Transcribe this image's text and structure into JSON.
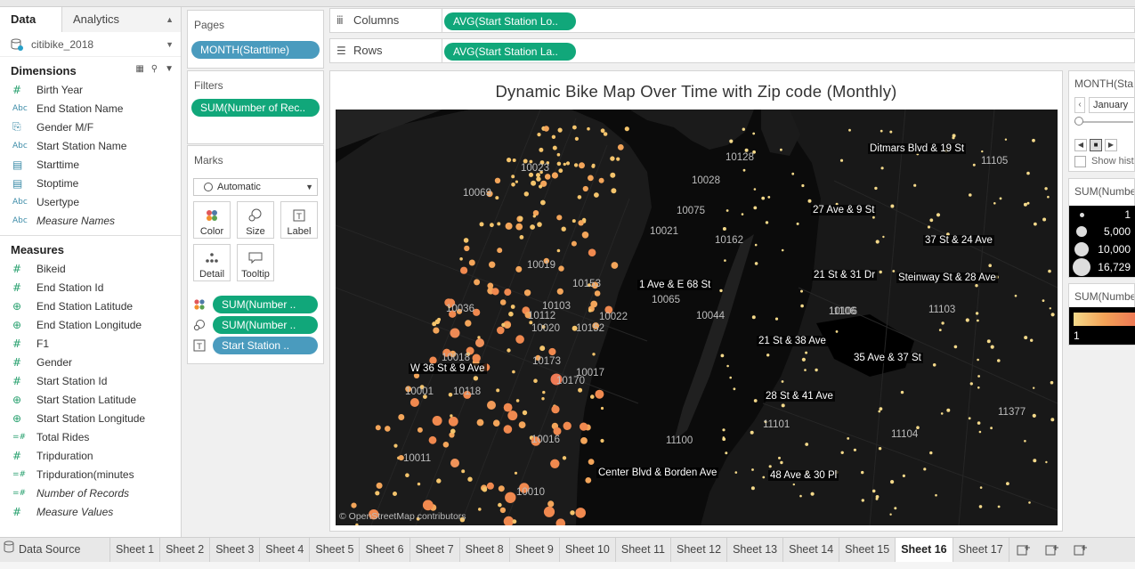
{
  "left_pane": {
    "tabs": [
      "Data",
      "Analytics"
    ],
    "datasource": "citibike_2018",
    "dimensions_title": "Dimensions",
    "measures_title": "Measures",
    "dimensions": [
      {
        "label": "Birth Year",
        "type": "#"
      },
      {
        "label": "End Station Name",
        "type": "Abc"
      },
      {
        "label": "Gender M/F",
        "type": "clip"
      },
      {
        "label": "Start Station Name",
        "type": "Abc"
      },
      {
        "label": "Starttime",
        "type": "date"
      },
      {
        "label": "Stoptime",
        "type": "date"
      },
      {
        "label": "Usertype",
        "type": "Abc"
      },
      {
        "label": "Measure Names",
        "type": "Abc",
        "italic": true
      }
    ],
    "measures": [
      {
        "label": "Bikeid",
        "type": "#"
      },
      {
        "label": "End Station Id",
        "type": "#"
      },
      {
        "label": "End Station Latitude",
        "type": "globe"
      },
      {
        "label": "End Station Longitude",
        "type": "globe"
      },
      {
        "label": "F1",
        "type": "#"
      },
      {
        "label": "Gender",
        "type": "#"
      },
      {
        "label": "Start Station Id",
        "type": "#"
      },
      {
        "label": "Start Station Latitude",
        "type": "globe"
      },
      {
        "label": "Start Station Longitude",
        "type": "globe"
      },
      {
        "label": "Total Rides",
        "type": "=#"
      },
      {
        "label": "Tripduration",
        "type": "#"
      },
      {
        "label": "Tripduration(minutes",
        "type": "=#"
      },
      {
        "label": "Number of Records",
        "type": "=#",
        "italic": true
      },
      {
        "label": "Measure Values",
        "type": "#",
        "italic": true
      }
    ]
  },
  "pages": {
    "title": "Pages",
    "pill": "MONTH(Starttime)"
  },
  "filters": {
    "title": "Filters",
    "pill": "SUM(Number of Rec.."
  },
  "marks": {
    "title": "Marks",
    "type": "Automatic",
    "buttons": [
      "Color",
      "Size",
      "Label",
      "Detail",
      "Tooltip"
    ],
    "pills": [
      "SUM(Number ..",
      "SUM(Number ..",
      "Start Station .."
    ]
  },
  "shelves": {
    "columns_label": "Columns",
    "columns_pill": "AVG(Start Station Lo..",
    "rows_label": "Rows",
    "rows_pill": "AVG(Start Station La.."
  },
  "view": {
    "title": "Dynamic Bike Map Over Time with Zip code (Monthly)",
    "credit": "© OpenStreetMap contributors",
    "zip_labels": [
      "10023",
      "10128",
      "10069",
      "10028",
      "10075",
      "10021",
      "10162",
      "10019",
      "10153",
      "10065",
      "10036",
      "10112",
      "10103",
      "10022",
      "10020",
      "10152",
      "10044",
      "10106",
      "10017",
      "10173",
      "10018",
      "10001",
      "10118",
      "10170",
      "10016",
      "10011",
      "10010",
      "11105",
      "11106",
      "11103",
      "11100",
      "11101",
      "11104",
      "11377"
    ],
    "station_labels": [
      "Ditmars Blvd & 19 St",
      "27 Ave & 9 St",
      "37 St & 24 Ave",
      "1 Ave & E 68 St",
      "21 St & 31 Dr",
      "Steinway St & 28 Ave",
      "21 St & 38 Ave",
      "W 36 St & 9 Ave",
      "35 Ave & 37 St",
      "28 St & 41 Ave",
      "Center Blvd & Borden Ave",
      "48 Ave & 30 Pl"
    ]
  },
  "page_control": {
    "title": "MONTH(Sta",
    "value": "January",
    "show_history": "Show hist"
  },
  "size_legend": {
    "title": "SUM(Numbe",
    "items": [
      "1",
      "5,000",
      "10,000",
      "16,729"
    ]
  },
  "color_legend": {
    "title": "SUM(Numbe",
    "min": "1"
  },
  "sheet_tabs": {
    "datasource": "Data Source",
    "sheets": [
      "Sheet 1",
      "Sheet 2",
      "Sheet 3",
      "Sheet 4",
      "Sheet 5",
      "Sheet 6",
      "Sheet 7",
      "Sheet 8",
      "Sheet 9",
      "Sheet 10",
      "Sheet 11",
      "Sheet 12",
      "Sheet 13",
      "Sheet 14",
      "Sheet 15",
      "Sheet 16",
      "Sheet 17"
    ],
    "active": "Sheet 16"
  }
}
